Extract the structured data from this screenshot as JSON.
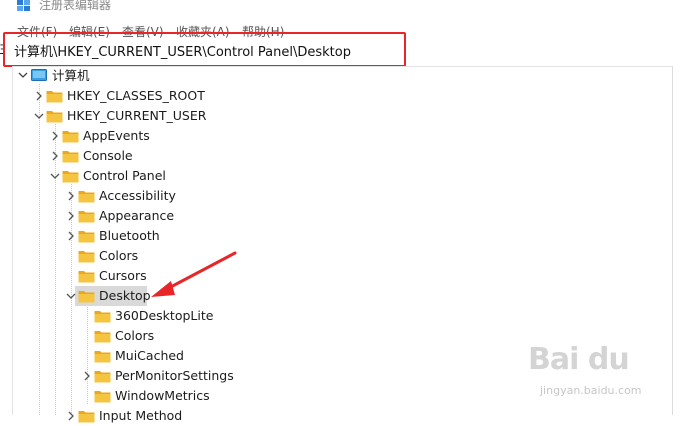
{
  "window": {
    "title": "注册表编辑器"
  },
  "menu": [
    "文件(F)",
    "编辑(E)",
    "查看(V)",
    "收藏夹(A)",
    "帮助(H)"
  ],
  "address": {
    "path": "计算机\\HKEY_CURRENT_USER\\Control Panel\\Desktop",
    "edge_glyph": "注"
  },
  "tree": {
    "root": "计算机",
    "nodes": [
      {
        "label": "HKEY_CLASSES_ROOT",
        "expanded": false
      },
      {
        "label": "HKEY_CURRENT_USER",
        "expanded": true
      },
      {
        "label": "AppEvents",
        "expanded": false
      },
      {
        "label": "Console",
        "expanded": false
      },
      {
        "label": "Control Panel",
        "expanded": true
      },
      {
        "label": "Accessibility",
        "expanded": false
      },
      {
        "label": "Appearance",
        "expanded": false
      },
      {
        "label": "Bluetooth",
        "expanded": false
      },
      {
        "label": "Colors",
        "expanded": null
      },
      {
        "label": "Cursors",
        "expanded": null
      },
      {
        "label": "Desktop",
        "expanded": true,
        "selected": true
      },
      {
        "label": "360DesktopLite",
        "expanded": null
      },
      {
        "label": "Colors",
        "expanded": null
      },
      {
        "label": "MuiCached",
        "expanded": null
      },
      {
        "label": "PerMonitorSettings",
        "expanded": false
      },
      {
        "label": "WindowMetrics",
        "expanded": null
      },
      {
        "label": "Input Method",
        "expanded": false
      }
    ]
  },
  "watermark": {
    "brand": "Bai du",
    "sub": "jingyan.baidu.com"
  },
  "colors": {
    "annotation": "#e8262a",
    "folder": "#f5c542",
    "selection": "#d9d9d9"
  }
}
